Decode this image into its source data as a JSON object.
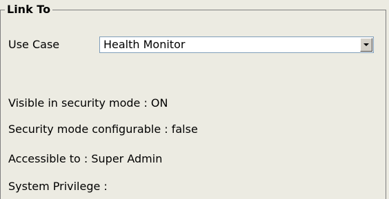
{
  "fieldset": {
    "legend": "Link To"
  },
  "use_case": {
    "label": "Use Case",
    "selected": "Health Monitor",
    "dropdown_icon": "chevron-down-icon"
  },
  "properties": {
    "visible_in_security_mode": "Visible in security mode : ON",
    "security_mode_configurable": "Security mode configurable : false",
    "accessible_to": "Accessible to : Super Admin",
    "system_privilege": "System Privilege :"
  },
  "colors": {
    "panel_background": "#ecebe2",
    "select_border": "#7f9db9"
  }
}
